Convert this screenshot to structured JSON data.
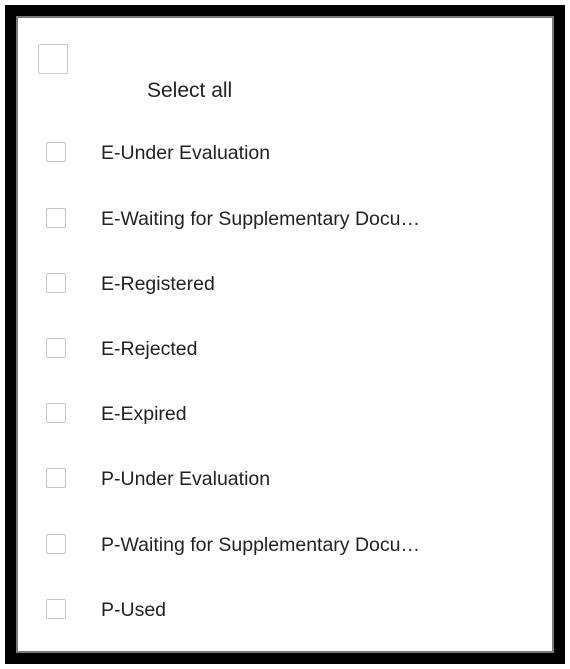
{
  "filter": {
    "select_all_label": "Select all",
    "options": [
      {
        "label": "E-Under Evaluation"
      },
      {
        "label": "E-Waiting for Supplementary Docu…"
      },
      {
        "label": "E-Registered"
      },
      {
        "label": "E-Rejected"
      },
      {
        "label": "E-Expired"
      },
      {
        "label": "P-Under Evaluation"
      },
      {
        "label": "P-Waiting for Supplementary Docu…"
      },
      {
        "label": "P-Used"
      }
    ]
  },
  "colors": {
    "frame": "#000000",
    "inner_border": "#7a7a7a",
    "checkbox_border": "#c4c4c4",
    "text": "#222222"
  }
}
